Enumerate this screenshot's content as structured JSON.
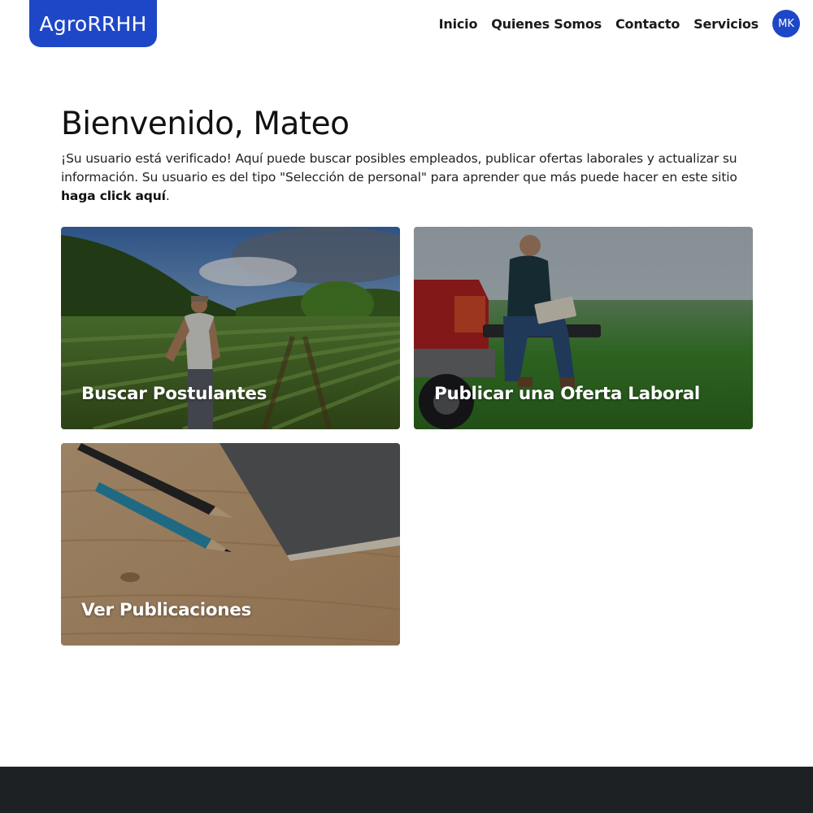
{
  "header": {
    "logo": "AgroRRHH",
    "nav": [
      "Inicio",
      "Quienes Somos",
      "Contacto",
      "Servicios"
    ],
    "avatar_initials": "MK"
  },
  "welcome": {
    "title": "Bienvenido, Mateo",
    "text": "¡Su usuario está verificado! Aquí puede buscar posibles empleados, publicar ofertas laborales y actualizar su información. Su usuario es del tipo \"Selección de personal\" para aprender que más puede hacer en este sitio ",
    "link": "haga click aquí",
    "tail": "."
  },
  "cards": [
    {
      "label": "Buscar Postulantes",
      "image": "farmer-in-cornfield"
    },
    {
      "label": "Publicar una Oferta Laboral",
      "image": "man-with-laptop-on-pickup"
    },
    {
      "label": "Ver Publicaciones",
      "image": "pencils-and-notebook"
    }
  ],
  "colors": {
    "brand": "#1e47c8",
    "footer": "#1e2124"
  }
}
